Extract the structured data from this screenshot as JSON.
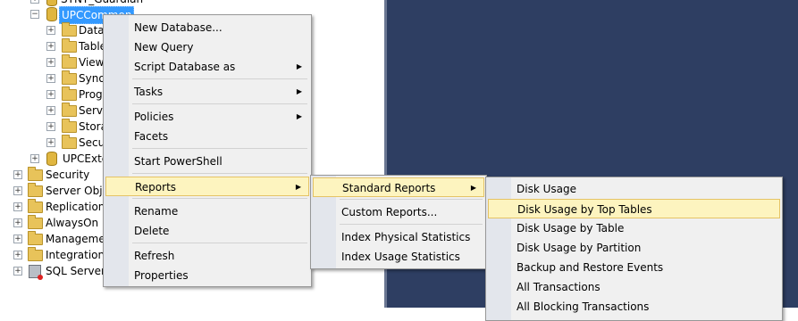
{
  "tree": {
    "partial_top": "SYNT_Guardian",
    "selected_db": "UPCCommon",
    "children": [
      "Data",
      "Table",
      "View",
      "Syno",
      "Prog",
      "Servi",
      "Stora",
      "Secu"
    ],
    "next_db": "UPCExte",
    "server_nodes": [
      "Security",
      "Server Objec",
      "Replication",
      "AlwaysOn H",
      "Managemen",
      "Integration S"
    ],
    "agent": "SQL Server A"
  },
  "context_menu": {
    "items": [
      "New Database...",
      "New Query",
      "Script Database as",
      "Tasks",
      "Policies",
      "Facets",
      "Start PowerShell",
      "Reports",
      "Rename",
      "Delete",
      "Refresh",
      "Properties"
    ]
  },
  "reports_menu": {
    "items": [
      "Standard Reports",
      "Custom Reports...",
      "Index Physical Statistics",
      "Index Usage Statistics"
    ]
  },
  "standard_reports_menu": {
    "items": [
      "Disk Usage",
      "Disk Usage by Top Tables",
      "Disk Usage by Table",
      "Disk Usage by Partition",
      "Backup and Restore Events",
      "All Transactions",
      "All Blocking Transactions"
    ]
  },
  "colors": {
    "dark_panel": "#2e3e62",
    "selection": "#3399ff",
    "menu_highlight": "#fdf4bf",
    "menu_highlight_border": "#e5c365"
  },
  "icons": [
    "expand-icon",
    "collapse-icon",
    "folder-icon",
    "database-icon",
    "sql-agent-icon",
    "submenu-arrow-icon"
  ]
}
